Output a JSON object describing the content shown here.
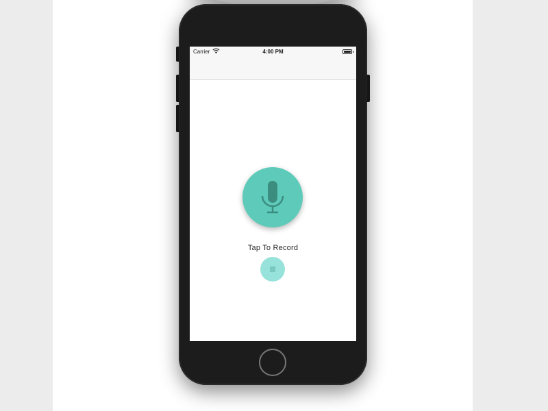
{
  "status_bar": {
    "carrier": "Carrier",
    "time": "4:00 PM",
    "wifi_icon": "wifi-icon",
    "battery_icon": "battery-icon"
  },
  "recorder": {
    "record_icon": "microphone-icon",
    "caption": "Tap To Record",
    "stop_icon": "stop-icon"
  },
  "colors": {
    "accent": "#5ecab9",
    "accent_light": "#97e2da",
    "mic_glyph": "#3b8d80",
    "phone_body": "#1c1c1c"
  }
}
